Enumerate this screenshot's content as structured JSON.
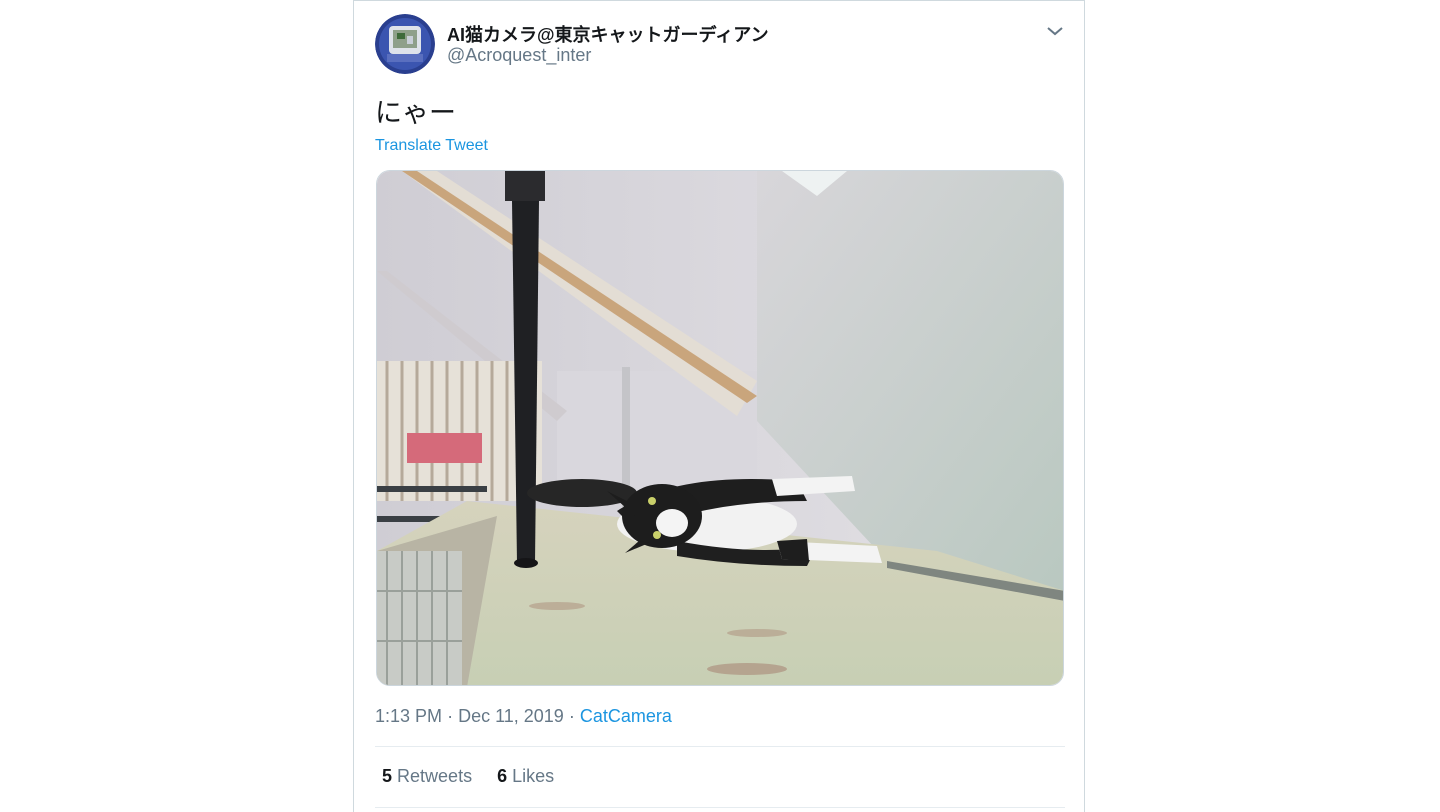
{
  "author": {
    "display_name": "AI猫カメラ@東京キャットガーディアン",
    "handle": "@Acroquest_inter",
    "avatar_icon": "avatar-image"
  },
  "tweet": {
    "text": "にゃー",
    "translate_label": "Translate Tweet",
    "time": "1:13 PM",
    "date": "Dec 11, 2019",
    "separator": "·",
    "source": "CatCamera"
  },
  "stats": {
    "retweets_count": "5",
    "retweets_label": "Retweets",
    "likes_count": "6",
    "likes_label": "Likes"
  },
  "icons": {
    "menu": "chevron-down-icon"
  },
  "colors": {
    "link": "#1b95e0",
    "text": "#14171a",
    "secondary": "#657786"
  }
}
